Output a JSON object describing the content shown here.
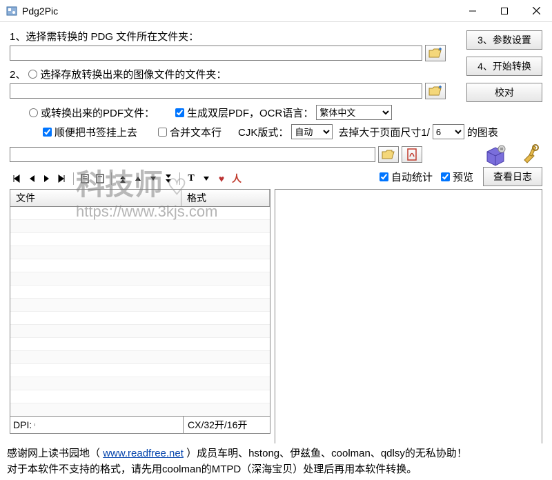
{
  "window": {
    "title": "Pdg2Pic"
  },
  "labels": {
    "step1": "1、选择需转换的 PDG 文件所在文件夹：",
    "step2_prefix": "2、",
    "step2": "选择存放转换出来的图像文件的文件夹：",
    "or_pdf": "或转换出来的PDF文件：",
    "gen_layer": "生成双层PDF，OCR语言：",
    "bookmark": "顺便把书签挂上去",
    "merge_text": "合并文本行",
    "cjk_layout": "CJK版式：",
    "drop_gt": "去掉大于页面尺寸1/",
    "chart_suffix": "的图表",
    "auto_stat": "自动统计",
    "preview": "预览",
    "dpi": "DPI:",
    "cx": "CX/32开/16开"
  },
  "buttons": {
    "params": "3、参数设置",
    "start": "4、开始转换",
    "verify": "校对",
    "view_log": "查看日志"
  },
  "selects": {
    "ocr_lang": "繁体中文",
    "cjk": "自动",
    "fraction": "6"
  },
  "inputs": {
    "path1": "",
    "path2": "",
    "path3": "",
    "dpi_val": ""
  },
  "checks": {
    "gen_layer": true,
    "bookmark": true,
    "merge_text": false,
    "auto_stat": true,
    "preview": true
  },
  "grid": {
    "col_file": "文件",
    "col_format": "格式"
  },
  "watermark": {
    "brand": "科技师",
    "url": "https://www.3kjs.com"
  },
  "footer": {
    "line1a": "感谢网上读书园地（",
    "link": "www.readfree.net",
    "line1b": "）成员车明、hstong、伊兹鱼、coolman、qdlsy的无私协助！",
    "line2": "对于本软件不支持的格式，请先用coolman的MTPD（深海宝贝）处理后再用本软件转换。"
  }
}
